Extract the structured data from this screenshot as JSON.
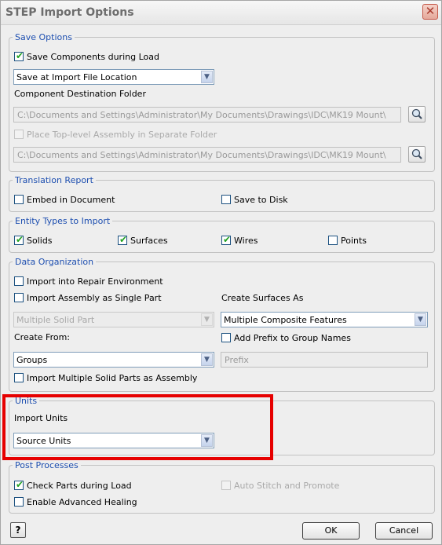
{
  "window": {
    "title": "STEP Import Options",
    "close_glyph": "✕"
  },
  "save_options": {
    "legend": "Save Options",
    "save_components": {
      "label": "Save Components during Load",
      "checked": true
    },
    "save_location": {
      "value": "Save at Import File Location"
    },
    "component_destination_label": "Component Destination Folder",
    "component_destination_path": "C:\\Documents and Settings\\Administrator\\My Documents\\Drawings\\IDC\\MK19 Mount\\",
    "place_top_level": {
      "label": "Place Top-level Assembly in Separate Folder",
      "checked": false,
      "enabled": false
    },
    "top_level_path": "C:\\Documents and Settings\\Administrator\\My Documents\\Drawings\\IDC\\MK19 Mount\\"
  },
  "translation_report": {
    "legend": "Translation Report",
    "embed": {
      "label": "Embed in Document",
      "checked": false
    },
    "save_to_disk": {
      "label": "Save to Disk",
      "checked": false
    }
  },
  "entity_types": {
    "legend": "Entity Types to Import",
    "solids": {
      "label": "Solids",
      "checked": true
    },
    "surfaces": {
      "label": "Surfaces",
      "checked": true
    },
    "wires": {
      "label": "Wires",
      "checked": true
    },
    "points": {
      "label": "Points",
      "checked": false
    }
  },
  "data_organization": {
    "legend": "Data Organization",
    "repair_env": {
      "label": "Import into Repair Environment",
      "checked": false
    },
    "single_part": {
      "label": "Import Assembly as Single Part",
      "checked": false
    },
    "solid_part_type": {
      "value": "Multiple Solid Part",
      "enabled": false
    },
    "create_surfaces_label": "Create Surfaces As",
    "create_surfaces_value": "Multiple Composite Features",
    "add_prefix": {
      "label": "Add Prefix to Group Names",
      "checked": false
    },
    "create_from_label": "Create From:",
    "create_from_value": "Groups",
    "prefix_placeholder": "Prefix",
    "multiple_solid_assembly": {
      "label": "Import Multiple Solid Parts as Assembly",
      "checked": false
    }
  },
  "units": {
    "legend": "Units",
    "import_units_label": "Import Units",
    "import_units_value": "Source Units"
  },
  "post_processes": {
    "legend": "Post Processes",
    "check_parts": {
      "label": "Check Parts during Load",
      "checked": true
    },
    "auto_stitch": {
      "label": "Auto Stitch and Promote",
      "checked": false,
      "enabled": false
    },
    "advanced_healing": {
      "label": "Enable Advanced Healing",
      "checked": false
    }
  },
  "footer": {
    "help_label": "?",
    "ok_label": "OK",
    "cancel_label": "Cancel"
  },
  "icons": {
    "dropdown": "dropdown-arrow-icon",
    "browse": "browse-folder-icon",
    "check": "checkmark-icon"
  },
  "colors": {
    "legend": "#1e4fb0",
    "highlight": "#e60000",
    "check": "#21a121"
  }
}
